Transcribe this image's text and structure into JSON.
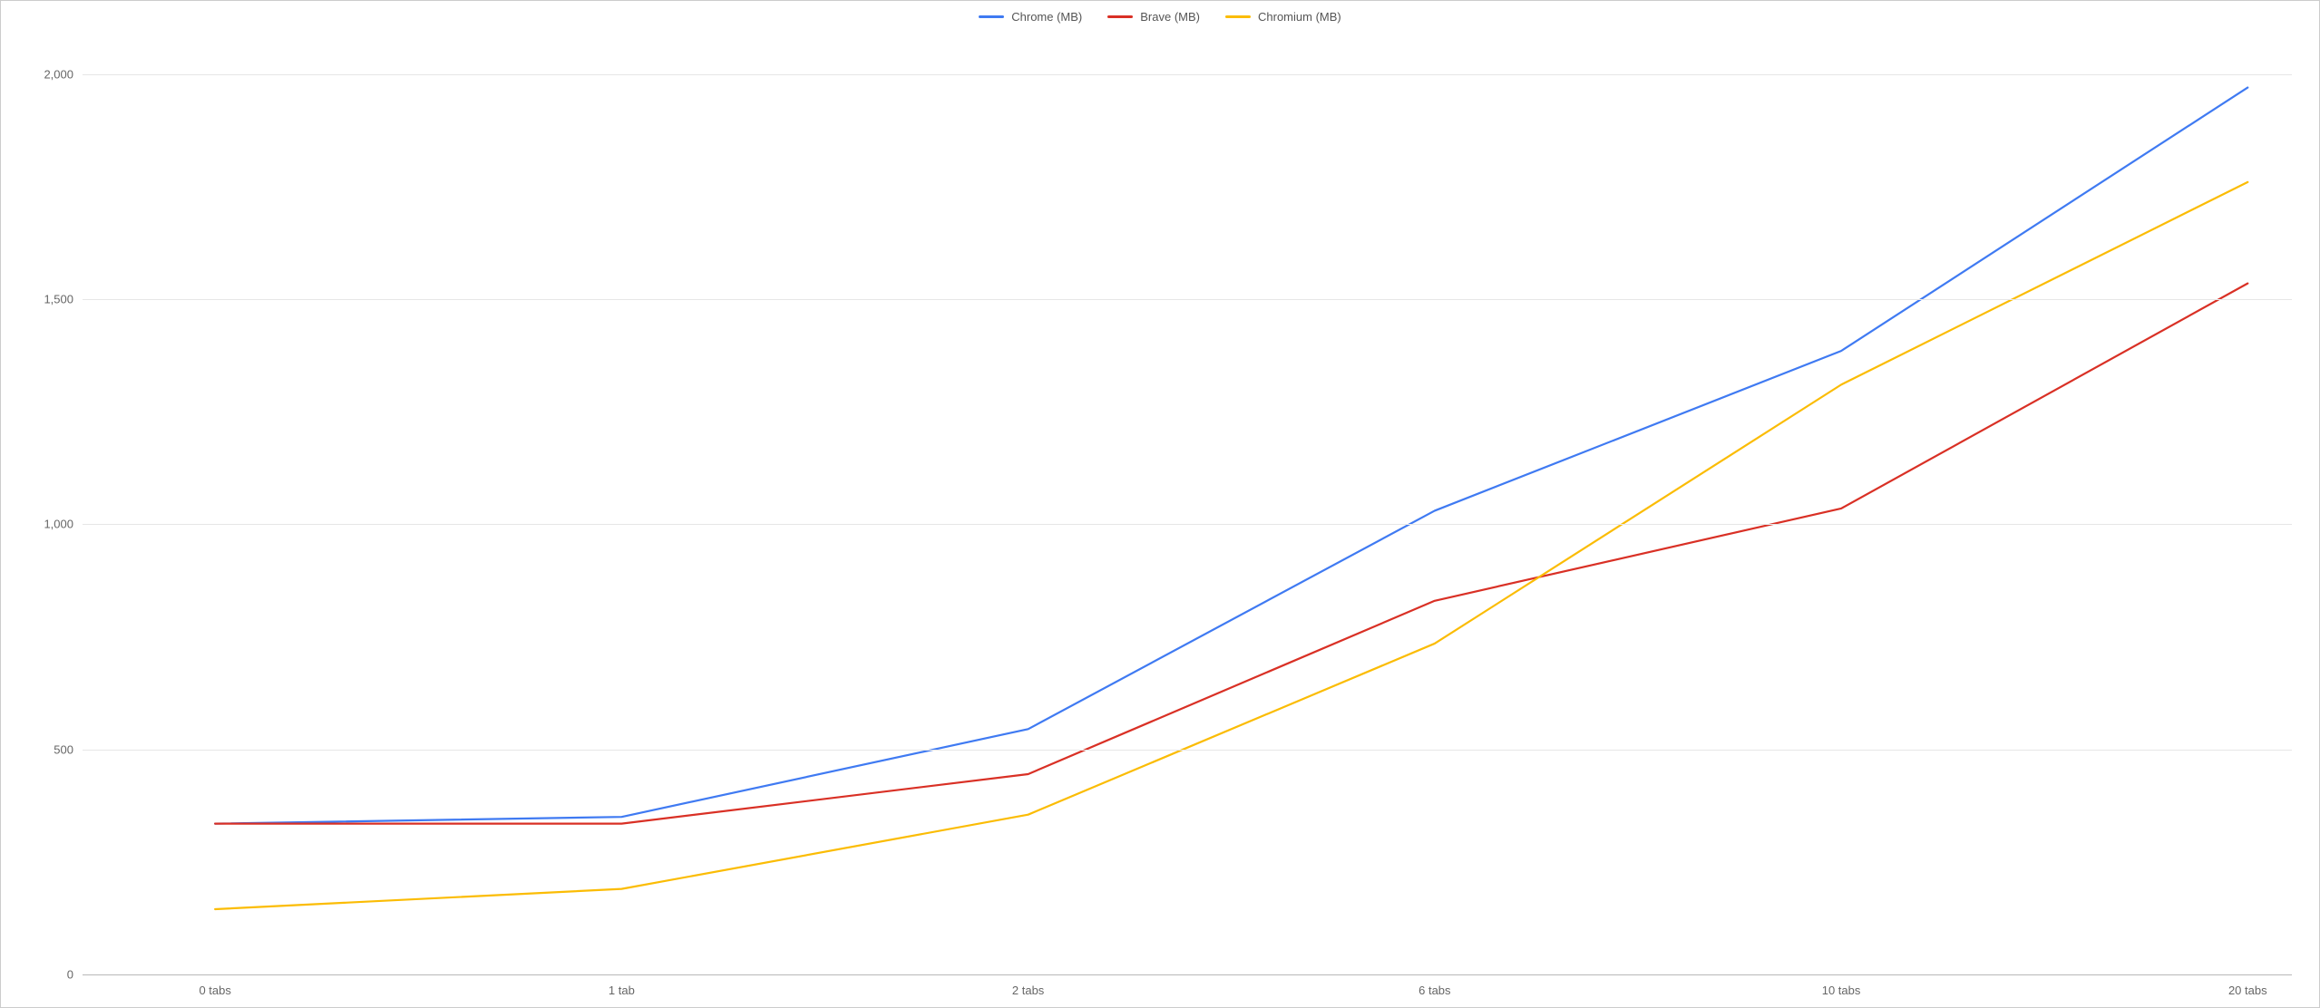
{
  "chart_data": {
    "type": "line",
    "title": "",
    "xlabel": "",
    "ylabel": "",
    "categories": [
      "0 tabs",
      "1 tab",
      "2 tabs",
      "6 tabs",
      "10 tabs",
      "20 tabs"
    ],
    "series": [
      {
        "name": "Chrome (MB)",
        "color": "#3f7af2",
        "values": [
          335,
          350,
          545,
          1030,
          1385,
          1970
        ]
      },
      {
        "name": "Brave (MB)",
        "color": "#d93025",
        "values": [
          335,
          335,
          445,
          830,
          1035,
          1535
        ]
      },
      {
        "name": "Chromium (MB)",
        "color": "#fbbc04",
        "values": [
          145,
          190,
          355,
          735,
          1310,
          1760
        ]
      }
    ],
    "y_ticks": [
      0,
      500,
      1000,
      1500,
      2000
    ],
    "y_tick_labels": [
      "0",
      "500",
      "1,000",
      "1,500",
      "2,000"
    ],
    "ylim": [
      0,
      2100
    ],
    "legend_position": "top",
    "grid": true
  }
}
